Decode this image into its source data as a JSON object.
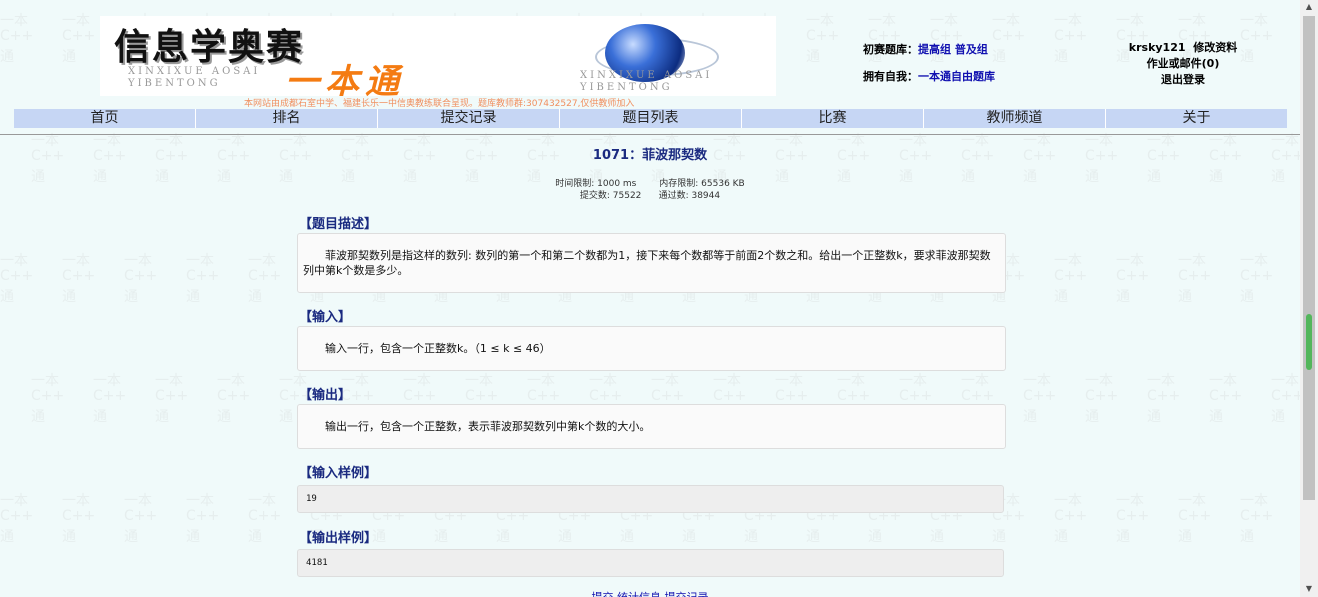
{
  "banner": {
    "title_cn": "信息学奥赛",
    "subtitle_cn": "一本通",
    "pinyin_left_1": "XINXIXUE  AOSAI",
    "pinyin_left_2": "YIBENTONG",
    "pinyin_right_1": "XINXIXUE  AOSAI",
    "pinyin_right_2": "YIBENTONG",
    "notice": "本网站由成都石室中学、福建长乐一中信奥教练联合呈现。题库教师群:307432527,仅供教师加入"
  },
  "header": {
    "chusai_label": "初赛题库：",
    "chusai_link1": "提高组",
    "chusai_link2": "普及组",
    "own_label": "拥有自我：",
    "own_link": "一本通自由题库"
  },
  "user": {
    "username": "krsky121",
    "edit_profile": "修改资料",
    "mail": "作业或邮件(0)",
    "logout": "退出登录"
  },
  "nav": [
    "首页",
    "排名",
    "提交记录",
    "题目列表",
    "比赛",
    "教师频道",
    "关于"
  ],
  "problem": {
    "title": "1071：菲波那契数",
    "time_limit": "时间限制: 1000 ms",
    "memory_limit": "内存限制: 65536 KB",
    "submissions": "提交数: 75522",
    "accepted": "通过数: 38944",
    "desc_title": "【题目描述】",
    "desc_text": "菲波那契数列是指这样的数列: 数列的第一个和第二个数都为1，接下来每个数都等于前面2个数之和。给出一个正整数k，要求菲波那契数列中第k个数是多少。",
    "input_title": "【输入】",
    "input_text": "输入一行，包含一个正整数k。（1 ≤ k ≤ 46）",
    "output_title": "【输出】",
    "output_text": "输出一行，包含一个正整数，表示菲波那契数列中第k个数的大小。",
    "sample_in_title": "【输入样例】",
    "sample_in": "19",
    "sample_out_title": "【输出样例】",
    "sample_out": "4181",
    "footer_links": "提交 统计信息 提交记录"
  },
  "watermark": {
    "top": "一本",
    "mid": "C++",
    "bot": "通"
  },
  "colors": {
    "background": "#f0fafa",
    "nav_bg": "#c6d6f4",
    "title_color": "#1a2a80",
    "link_color": "#1010b0",
    "banner_orange": "#f47b12"
  }
}
